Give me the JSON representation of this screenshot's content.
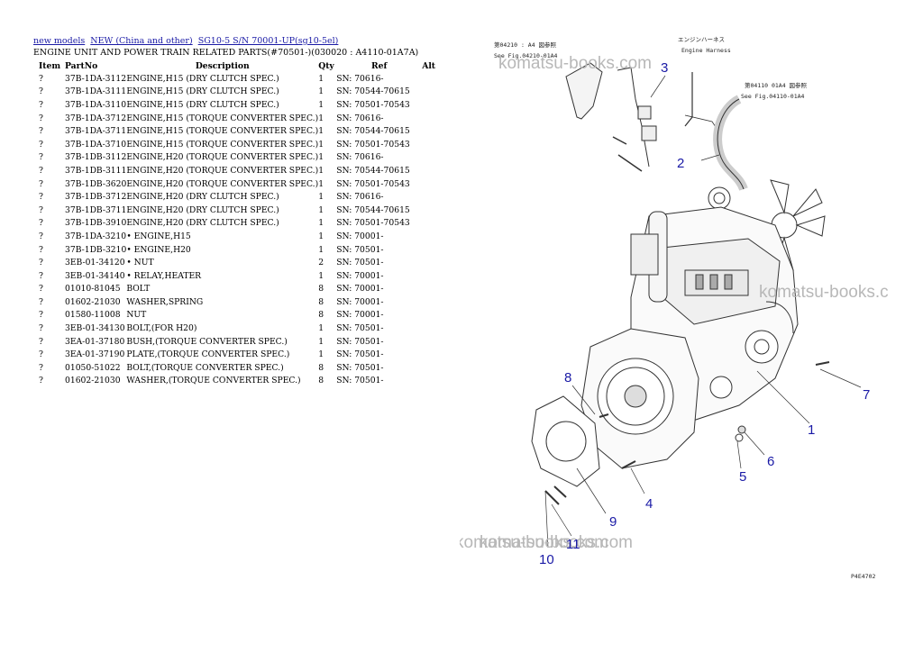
{
  "breadcrumb": {
    "link1": "new models",
    "link2": "NEW (China and other)",
    "link3": "SG10-5 S/N 70001-UP(sg10-5el)"
  },
  "page_title": "ENGINE UNIT AND POWER TRAIN RELATED PARTS(#70501-)(030020 : A4110-01A7A)",
  "table": {
    "headers": {
      "item": "Item",
      "partno": "PartNo",
      "description": "Description",
      "qty": "Qty",
      "ref": "Ref",
      "alt": "Alt"
    },
    "rows": [
      {
        "item": "?",
        "partno": "37B-1DA-3112",
        "description": "ENGINE,H15 (DRY CLUTCH SPEC.)",
        "qty": "1",
        "ref": "SN: 70616-"
      },
      {
        "item": "?",
        "partno": "37B-1DA-3111",
        "description": "ENGINE,H15 (DRY CLUTCH SPEC.)",
        "qty": "1",
        "ref": "SN: 70544-70615"
      },
      {
        "item": "?",
        "partno": "37B-1DA-3110",
        "description": "ENGINE,H15 (DRY CLUTCH SPEC.)",
        "qty": "1",
        "ref": "SN: 70501-70543"
      },
      {
        "item": "?",
        "partno": "37B-1DA-3712",
        "description": "ENGINE,H15 (TORQUE CONVERTER SPEC.)",
        "qty": "1",
        "ref": "SN: 70616-"
      },
      {
        "item": "?",
        "partno": "37B-1DA-3711",
        "description": "ENGINE,H15 (TORQUE CONVERTER SPEC.)",
        "qty": "1",
        "ref": "SN: 70544-70615"
      },
      {
        "item": "?",
        "partno": "37B-1DA-3710",
        "description": "ENGINE,H15 (TORQUE CONVERTER SPEC.)",
        "qty": "1",
        "ref": "SN: 70501-70543"
      },
      {
        "item": "?",
        "partno": "37B-1DB-3112",
        "description": "ENGINE,H20 (TORQUE CONVERTER SPEC.)",
        "qty": "1",
        "ref": "SN: 70616-"
      },
      {
        "item": "?",
        "partno": "37B-1DB-3111",
        "description": "ENGINE,H20 (TORQUE CONVERTER SPEC.)",
        "qty": "1",
        "ref": "SN: 70544-70615"
      },
      {
        "item": "?",
        "partno": "37B-1DB-3620",
        "description": "ENGINE,H20 (TORQUE CONVERTER SPEC.)",
        "qty": "1",
        "ref": "SN: 70501-70543"
      },
      {
        "item": "?",
        "partno": "37B-1DB-3712",
        "description": "ENGINE,H20 (DRY CLUTCH SPEC.)",
        "qty": "1",
        "ref": "SN: 70616-"
      },
      {
        "item": "?",
        "partno": "37B-1DB-3711",
        "description": "ENGINE,H20 (DRY CLUTCH SPEC.)",
        "qty": "1",
        "ref": "SN: 70544-70615"
      },
      {
        "item": "?",
        "partno": "37B-1DB-3910",
        "description": "ENGINE,H20 (DRY CLUTCH SPEC.)",
        "qty": "1",
        "ref": "SN: 70501-70543"
      },
      {
        "item": "?",
        "partno": "37B-1DA-3210",
        "description": "• ENGINE,H15",
        "qty": "1",
        "ref": "SN: 70001-"
      },
      {
        "item": "?",
        "partno": "37B-1DB-3210",
        "description": "• ENGINE,H20",
        "qty": "1",
        "ref": "SN: 70501-"
      },
      {
        "item": "?",
        "partno": "3EB-01-34120",
        "description": "• NUT",
        "qty": "2",
        "ref": "SN: 70501-"
      },
      {
        "item": "?",
        "partno": "3EB-01-34140",
        "description": "• RELAY,HEATER",
        "qty": "1",
        "ref": "SN: 70001-"
      },
      {
        "item": "?",
        "partno": "01010-81045",
        "description": "BOLT",
        "qty": "8",
        "ref": "SN: 70001-"
      },
      {
        "item": "?",
        "partno": "01602-21030",
        "description": "WASHER,SPRING",
        "qty": "8",
        "ref": "SN: 70001-"
      },
      {
        "item": "?",
        "partno": "01580-11008",
        "description": "NUT",
        "qty": "8",
        "ref": "SN: 70001-"
      },
      {
        "item": "?",
        "partno": "3EB-01-34130",
        "description": "BOLT,(FOR H20)",
        "qty": "1",
        "ref": "SN: 70501-"
      },
      {
        "item": "?",
        "partno": "3EA-01-37180",
        "description": "BUSH,(TORQUE CONVERTER SPEC.)",
        "qty": "1",
        "ref": "SN: 70501-"
      },
      {
        "item": "?",
        "partno": "3EA-01-37190",
        "description": "PLATE,(TORQUE CONVERTER SPEC.)",
        "qty": "1",
        "ref": "SN: 70501-"
      },
      {
        "item": "?",
        "partno": "01050-51022",
        "description": "BOLT,(TORQUE CONVERTER SPEC.)",
        "qty": "8",
        "ref": "SN: 70501-"
      },
      {
        "item": "?",
        "partno": "01602-21030",
        "description": "WASHER,(TORQUE CONVERTER SPEC.)",
        "qty": "8",
        "ref": "SN: 70501-"
      }
    ]
  },
  "diagram": {
    "notes": {
      "note_jp_left": "第04210 : A4 図参照",
      "note_en_left": "See Fig.04210-01A4",
      "note_jp_top": "エンジンハーネス",
      "note_en_top": "Engine Harness",
      "note_jp_right": "第04110 01A4 図参照",
      "note_en_right": "See Fig.04110-01A4",
      "corner_code": "P4E4702"
    },
    "callouts": {
      "c1": "1",
      "c2": "2",
      "c3": "3",
      "c4": "4",
      "c5": "5",
      "c6": "6",
      "c7": "7",
      "c8": "8",
      "c9": "9",
      "c10": "10",
      "c11": "11"
    },
    "watermarks": {
      "w1": "komatsu-books.com",
      "w2": "komatsu-books.c",
      "w3": "komatsu-books.com",
      "w4": "komatsu-books.com"
    }
  }
}
